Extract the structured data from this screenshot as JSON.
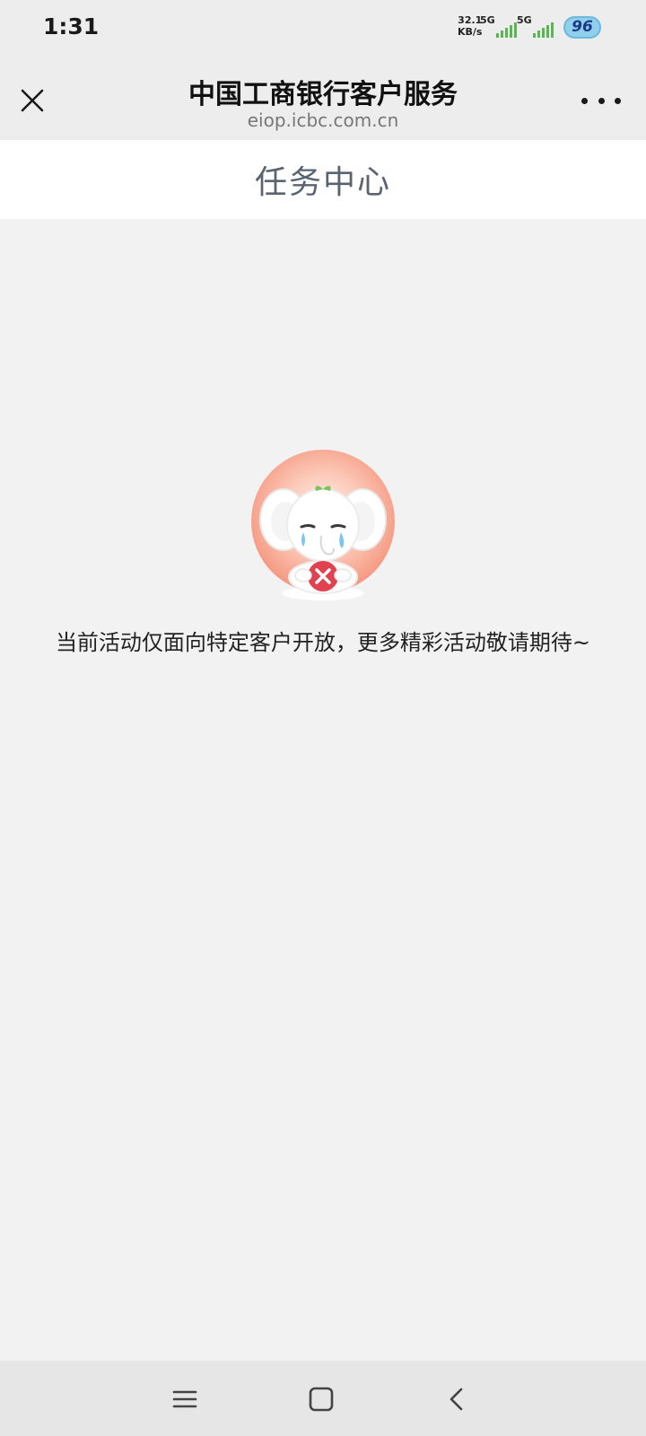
{
  "status_bar": {
    "time": "1:31",
    "net_speed_value": "32.1",
    "net_speed_unit": "KB/s",
    "sim1_label": "5G",
    "sim2_label": "5G",
    "battery_level": "96"
  },
  "nav_bar": {
    "title": "中国工商银行客户服务",
    "url": "eiop.icbc.com.cn"
  },
  "page": {
    "title": "任务中心",
    "empty_message": "当前活动仅面向特定客户开放，更多精彩活动敬请期待~"
  },
  "icons": {
    "close": "close-icon",
    "more": "more-icon",
    "mascot": "crying-elephant-mascot",
    "menu": "menu-icon",
    "home": "home-icon",
    "back": "back-icon"
  },
  "colors": {
    "signal": "#5ab552",
    "battery_fill": "#8fd0ec",
    "mascot_bg": "#f7a08e",
    "error_badge": "#e0424f"
  }
}
